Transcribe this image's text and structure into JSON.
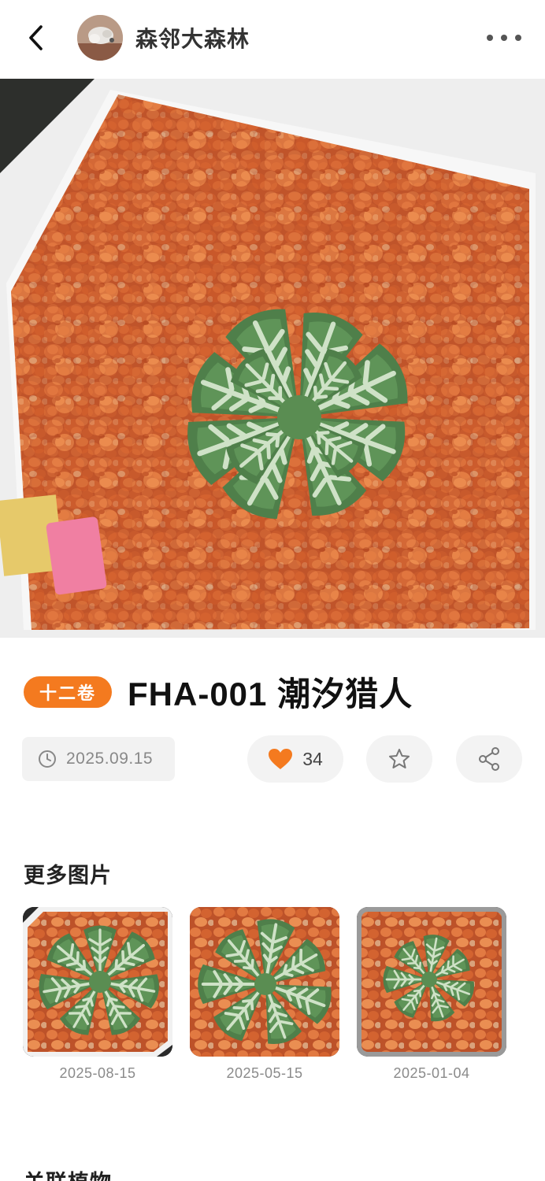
{
  "header": {
    "back_icon": "chevron-left-icon",
    "shop_name": "森邻大森林",
    "more_icon": "more-horizontal-icon"
  },
  "hero": {
    "description_icon": "plant-photo"
  },
  "product": {
    "badge": "十二卷",
    "title": "FHA-001 潮汐猎人",
    "date": "2025.09.15",
    "likes": "34",
    "accent_color": "#f47a1f"
  },
  "more_images": {
    "heading": "更多图片",
    "items": [
      {
        "date": "2025-08-15"
      },
      {
        "date": "2025-05-15"
      },
      {
        "date": "2025-01-04"
      }
    ]
  },
  "related": {
    "heading": "关联植物"
  }
}
